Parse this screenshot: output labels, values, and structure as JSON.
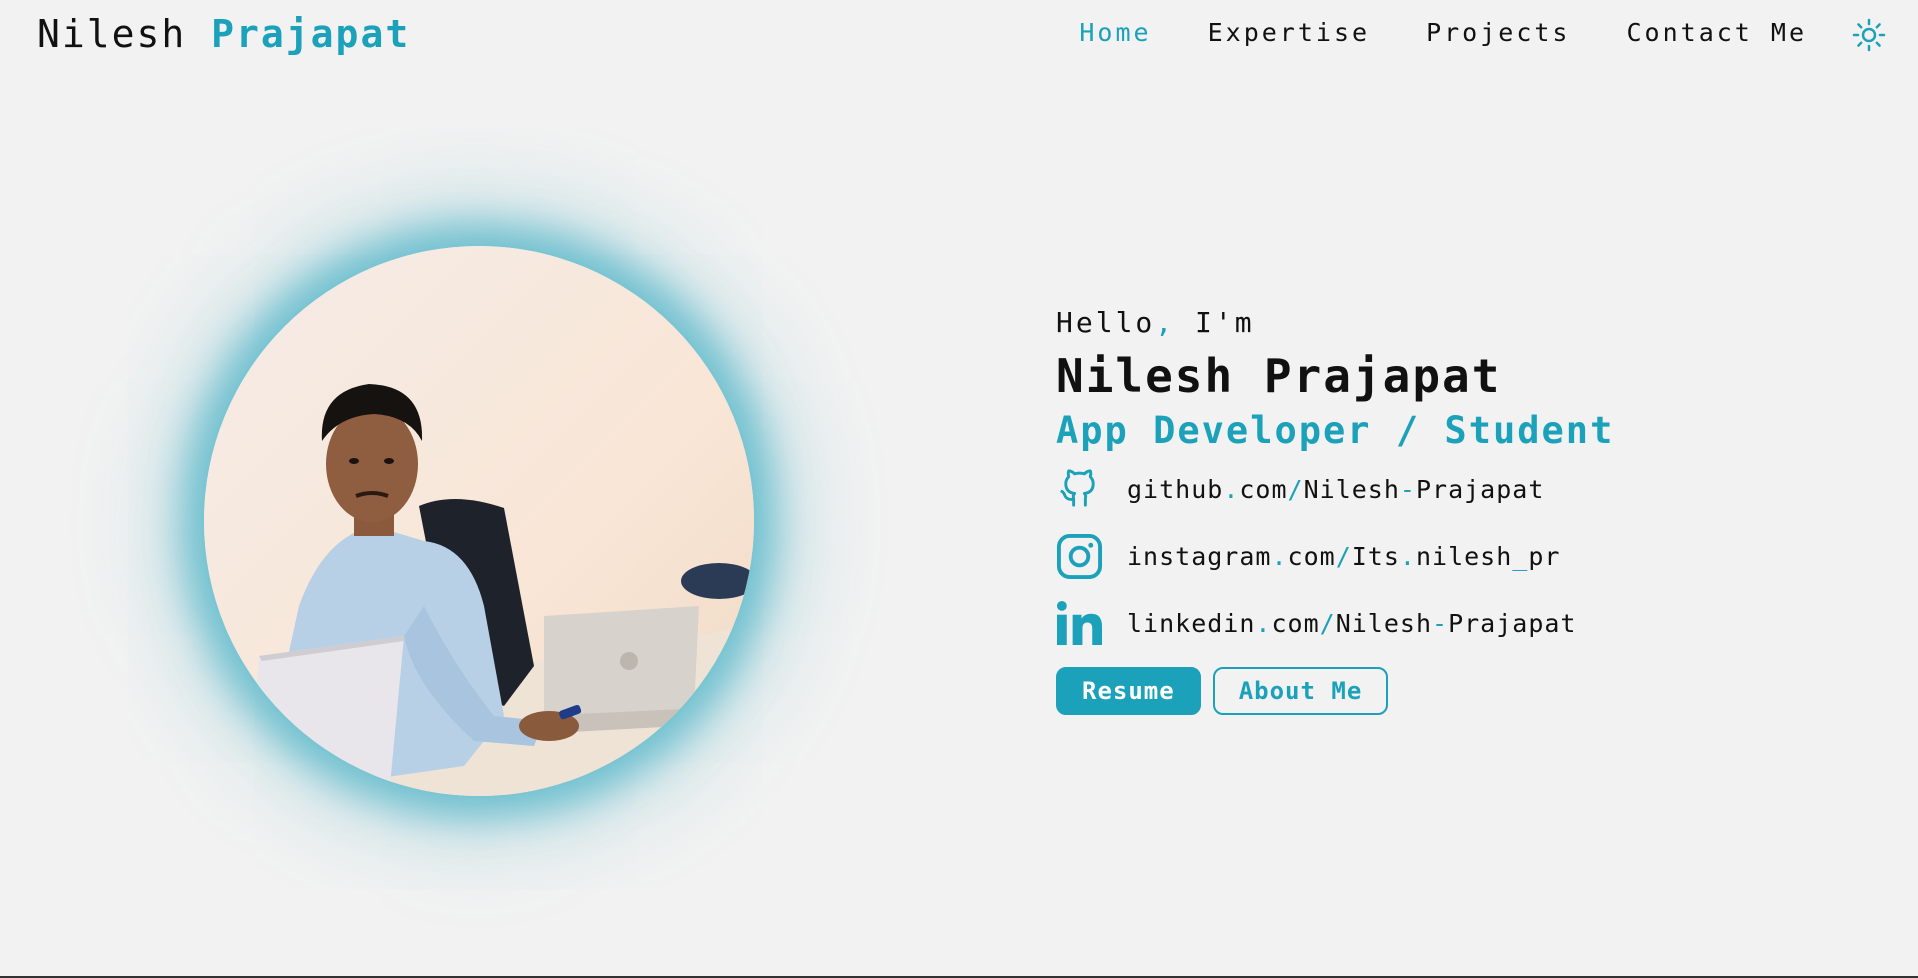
{
  "header": {
    "logo_first": "Nilesh",
    "logo_last": "Prajapat",
    "nav": [
      {
        "label": "Home",
        "active": true
      },
      {
        "label": "Expertise",
        "active": false
      },
      {
        "label": "Projects",
        "active": false
      },
      {
        "label": "Contact Me",
        "active": false
      }
    ],
    "theme_icon": "sun-icon"
  },
  "hero": {
    "greeting_a": "Hello",
    "greeting_comma": ",",
    "greeting_b": " I'm",
    "name": "Nilesh Prajapat",
    "role": "App Developer / Student",
    "links": [
      {
        "icon": "github-icon",
        "parts": [
          "github",
          ".",
          "com",
          "/",
          "Nilesh",
          "-",
          "Prajapat"
        ]
      },
      {
        "icon": "instagram-icon",
        "parts": [
          "instagram",
          ".",
          "com",
          "/",
          "Its",
          ".",
          "nilesh",
          "_",
          "pr"
        ]
      },
      {
        "icon": "linkedin-icon",
        "parts": [
          "linkedin",
          ".",
          "com",
          "/",
          "Nilesh",
          "-",
          "Prajapat"
        ]
      }
    ],
    "resume_label": "Resume",
    "about_label": "About Me"
  },
  "colors": {
    "accent": "#1ba1b9",
    "background": "#f2f2f2",
    "text": "#111111"
  }
}
